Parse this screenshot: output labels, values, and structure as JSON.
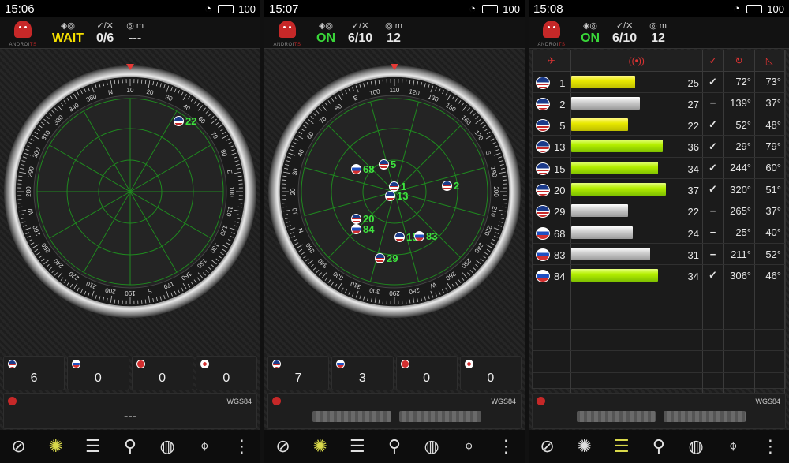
{
  "screens": [
    {
      "time": "15:06",
      "battery": "100",
      "logo": {
        "prefix": "ANDROI",
        "suffix": "TS"
      },
      "header": {
        "status": "WAIT",
        "status_kind": "wait",
        "sats": "0/6",
        "accuracy": "---",
        "acc_unit": "m"
      },
      "compass_ticks": [
        "330",
        "340",
        "350",
        "N",
        "10",
        "20",
        "30",
        "40",
        "60",
        "70",
        "80",
        "E",
        "100",
        "110",
        "120",
        "130",
        "150",
        "160",
        "170",
        "S",
        "190",
        "200",
        "210",
        "220",
        "240",
        "250",
        "260",
        "W",
        "280",
        "290",
        "300",
        "310"
      ],
      "satellites": [
        {
          "label": "22",
          "flag": "us"
        }
      ],
      "counts": [
        {
          "flag": "us",
          "value": "6"
        },
        {
          "flag": "ru",
          "value": "0"
        },
        {
          "flag": "cn",
          "value": "0"
        },
        {
          "flag": "jp",
          "value": "0"
        }
      ],
      "coord": {
        "datum": "WGS84",
        "value": "---"
      }
    },
    {
      "time": "15:07",
      "battery": "100",
      "logo": {
        "prefix": "ANDROI",
        "suffix": "TS"
      },
      "header": {
        "status": "ON",
        "status_kind": "on",
        "sats": "6/10",
        "accuracy": "12",
        "acc_unit": "m"
      },
      "compass_ticks": [
        "70",
        "80",
        "E",
        "100",
        "110",
        "120",
        "130",
        "150",
        "160",
        "170",
        "S",
        "190",
        "200",
        "210",
        "220",
        "240",
        "250",
        "260",
        "W",
        "280",
        "290",
        "300",
        "310",
        "330",
        "340",
        "350",
        "N",
        "10",
        "20",
        "30",
        "40",
        "60"
      ],
      "satellites": [
        {
          "label": "68",
          "flag": "ru"
        },
        {
          "label": "5",
          "flag": "us"
        },
        {
          "label": "1",
          "flag": "us"
        },
        {
          "label": "13",
          "flag": "us"
        },
        {
          "label": "2",
          "flag": "us"
        },
        {
          "label": "20",
          "flag": "us"
        },
        {
          "label": "84",
          "flag": "ru"
        },
        {
          "label": "15",
          "flag": "us"
        },
        {
          "label": "83",
          "flag": "ru"
        },
        {
          "label": "29",
          "flag": "us"
        }
      ],
      "counts": [
        {
          "flag": "us",
          "value": "7"
        },
        {
          "flag": "ru",
          "value": "3"
        },
        {
          "flag": "cn",
          "value": "0"
        },
        {
          "flag": "jp",
          "value": "0"
        }
      ],
      "coord": {
        "datum": "WGS84",
        "value": ""
      }
    },
    {
      "time": "15:08",
      "battery": "100",
      "logo": {
        "prefix": "ANDROI",
        "suffix": "TS"
      },
      "header": {
        "status": "ON",
        "status_kind": "on",
        "sats": "6/10",
        "accuracy": "12",
        "acc_unit": "m"
      },
      "table": {
        "rows": [
          {
            "flag": "us",
            "prn": "1",
            "snr": "25",
            "snr_frac": 0.68,
            "bar": "yel",
            "fix": true,
            "az": "72°",
            "el": "73°"
          },
          {
            "flag": "us",
            "prn": "2",
            "snr": "27",
            "snr_frac": 0.73,
            "bar": "gry",
            "fix": false,
            "az": "139°",
            "el": "37°"
          },
          {
            "flag": "us",
            "prn": "5",
            "snr": "22",
            "snr_frac": 0.6,
            "bar": "yel",
            "fix": true,
            "az": "52°",
            "el": "48°"
          },
          {
            "flag": "us",
            "prn": "13",
            "snr": "36",
            "snr_frac": 0.97,
            "bar": "grn",
            "fix": true,
            "az": "29°",
            "el": "79°"
          },
          {
            "flag": "us",
            "prn": "15",
            "snr": "34",
            "snr_frac": 0.92,
            "bar": "grn",
            "fix": true,
            "az": "244°",
            "el": "60°"
          },
          {
            "flag": "us",
            "prn": "20",
            "snr": "37",
            "snr_frac": 1.0,
            "bar": "grn",
            "fix": true,
            "az": "320°",
            "el": "51°"
          },
          {
            "flag": "us",
            "prn": "29",
            "snr": "22",
            "snr_frac": 0.6,
            "bar": "gry",
            "fix": false,
            "az": "265°",
            "el": "37°"
          },
          {
            "flag": "ru",
            "prn": "68",
            "snr": "24",
            "snr_frac": 0.65,
            "bar": "gry",
            "fix": false,
            "az": "25°",
            "el": "40°"
          },
          {
            "flag": "ru",
            "prn": "83",
            "snr": "31",
            "snr_frac": 0.84,
            "bar": "gry",
            "fix": false,
            "az": "211°",
            "el": "52°"
          },
          {
            "flag": "ru",
            "prn": "84",
            "snr": "34",
            "snr_frac": 0.92,
            "bar": "grn",
            "fix": true,
            "az": "306°",
            "el": "46°"
          }
        ]
      },
      "coord": {
        "datum": "WGS84",
        "value": ""
      }
    }
  ],
  "colors": {
    "status_wait": "#f6e000",
    "status_on": "#39d639",
    "grid": "#1f8a1f",
    "sat_label": "#3ee33e"
  },
  "nav_icons": [
    "compass-icon",
    "radar-icon",
    "signal-table-icon",
    "walk-icon",
    "globe-icon",
    "location-pin-icon",
    "more-icon"
  ]
}
